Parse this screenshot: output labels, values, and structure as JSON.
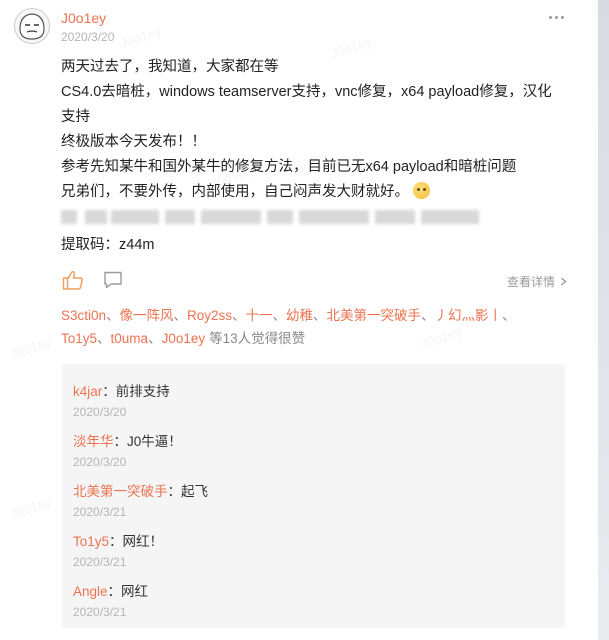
{
  "post": {
    "author": "J0o1ey",
    "date": "2020/3/20",
    "lines": [
      "两天过去了，我知道，大家都在等",
      "CS4.0去暗桩，windows teamserver支持，vnc修复，x64 payload修复，汉化",
      "支持",
      "终极版本今天发布！！",
      "参考先知某牛和国外某牛的修复方法，目前已无x64 payload和暗桩问题",
      "兄弟们，不要外传，内部使用，自己闷声发大财就好。"
    ],
    "extraction_code": "提取码：z44m"
  },
  "actions": {
    "details_label": "查看详情"
  },
  "likes": {
    "names": [
      "S3cti0n",
      "像一阵风",
      "Roy2ss",
      "十一",
      "幼稚",
      "北美第一突破手",
      "丿幻灬影丨",
      "To1y5",
      "t0uma",
      "J0o1ey"
    ],
    "separator": "、",
    "suffix": "等13人觉得很赞"
  },
  "comments": [
    {
      "name": "k4jar",
      "text": "前排支持",
      "date": "2020/3/20"
    },
    {
      "name": "淡年华",
      "text": "J0牛逼！",
      "date": "2020/3/20"
    },
    {
      "name": "北美第一突破手",
      "text": "起飞",
      "date": "2020/3/21"
    },
    {
      "name": "To1y5",
      "text": "网红！",
      "date": "2020/3/21"
    },
    {
      "name": "Angle",
      "text": "网红",
      "date": "2020/3/21"
    }
  ],
  "colors": {
    "accent": "#eb7350",
    "muted": "#b5b5b5",
    "comment_bg": "#f5f5f5"
  },
  "icons": [
    "more-icon",
    "like-icon",
    "comment-icon",
    "chevron-right-icon",
    "emoji-icon"
  ]
}
